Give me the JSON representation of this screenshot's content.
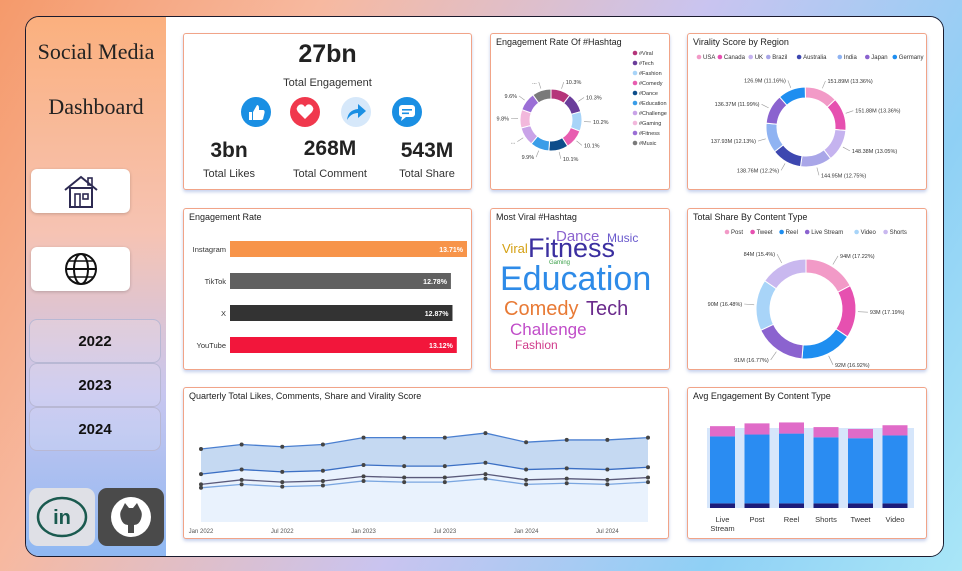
{
  "sidebar": {
    "title_line1": "Social Media",
    "title_line2": "Dashboard",
    "nav": [
      {
        "icon": "home-icon"
      },
      {
        "icon": "globe-icon"
      }
    ],
    "years": [
      "2022",
      "2023",
      "2024"
    ],
    "social": [
      {
        "icon": "linkedin-icon"
      },
      {
        "icon": "github-icon"
      }
    ]
  },
  "kpi": {
    "total_engagement_value": "27bn",
    "total_engagement_label": "Total Engagement",
    "likes_value": "3bn",
    "likes_label": "Total Likes",
    "comment_value": "268M",
    "comment_label": "Total Comment",
    "share_value": "543M",
    "share_label": "Total Share",
    "icons": [
      "like-icon",
      "heart-icon",
      "share-icon",
      "comment-icon"
    ],
    "icon_color": "#1a8fe3",
    "heart_color": "#f0384d"
  },
  "chart_data": [
    {
      "id": "hashtag_engagement",
      "type": "pie",
      "title": "Engagement Rate Of #Hashtag",
      "donut": true,
      "labels": [
        "#Viral",
        "#Tech",
        "#Fashion",
        "#Comedy",
        "#Dance",
        "#Education",
        "#Challenge",
        "#Gaming",
        "#Fitness",
        "#Music"
      ],
      "values": [
        10.3,
        10.3,
        10.2,
        10.1,
        10.1,
        9.9,
        9.8,
        9.6,
        9.6,
        9.9
      ],
      "data_labels": [
        "10.3%",
        "10.3%",
        "10.2%",
        "10.1%",
        "10.1%",
        "9.9%",
        "...",
        "9.8%",
        "9.6%",
        "..."
      ],
      "colors": [
        "#b5357a",
        "#6a3d9a",
        "#a8d4f8",
        "#e85db0",
        "#0d4d8a",
        "#3a9de8",
        "#c9a3e8",
        "#f2b8dc",
        "#9b6fd6",
        "#7a7a7a"
      ],
      "legend_position": "right"
    },
    {
      "id": "virality_region",
      "type": "pie",
      "title": "Virality Score by Region",
      "donut": true,
      "labels": [
        "USA",
        "Canada",
        "UK",
        "Brazil",
        "Australia",
        "India",
        "Japan",
        "Germany"
      ],
      "values": [
        151.89,
        151.88,
        148.38,
        144.95,
        138.76,
        137.93,
        136.37,
        126.9
      ],
      "data_labels": [
        "151.89M (13.36%)",
        "151.88M (13.36%)",
        "148.38M (13.05%)",
        "144.95M (12.75%)",
        "138.76M (12.2%)",
        "137.93M (12.13%)",
        "136.37M (11.99%)",
        "126.9M (11.16%)"
      ],
      "colors": [
        "#f29ac7",
        "#e650b0",
        "#c5b3ef",
        "#a9a6e8",
        "#3d47b0",
        "#8fb3f2",
        "#8b63cf",
        "#1e8ef0"
      ],
      "legend_position": "top"
    },
    {
      "id": "engagement_rate",
      "type": "bar",
      "orientation": "horizontal",
      "title": "Engagement Rate",
      "categories": [
        "Instagram",
        "TikTok",
        "X",
        "YouTube"
      ],
      "values": [
        13.71,
        12.78,
        12.87,
        13.12
      ],
      "data_labels": [
        "13.71%",
        "12.78%",
        "12.87%",
        "13.12%"
      ],
      "colors": [
        "#f7944a",
        "#606060",
        "#333333",
        "#f2163b"
      ],
      "xlim": [
        0,
        13.71
      ]
    },
    {
      "id": "viral_hashtag_cloud",
      "type": "table",
      "title": "Most Viral #Hashtag",
      "words": [
        {
          "text": "Dance",
          "color": "#8b63cf"
        },
        {
          "text": "Music",
          "color": "#6a5acd"
        },
        {
          "text": "Viral",
          "color": "#d4a012"
        },
        {
          "text": "Fitness",
          "color": "#3b2fa0"
        },
        {
          "text": "Gaming",
          "color": "#3aa048"
        },
        {
          "text": "Education",
          "color": "#2e8be8"
        },
        {
          "text": "Comedy",
          "color": "#e87a35"
        },
        {
          "text": "Tech",
          "color": "#6a2a8c"
        },
        {
          "text": "Challenge",
          "color": "#c04cc8"
        },
        {
          "text": "Fashion",
          "color": "#d03a8a"
        }
      ]
    },
    {
      "id": "share_content_type",
      "type": "pie",
      "title": "Total Share By Content Type",
      "donut": true,
      "labels": [
        "Post",
        "Tweet",
        "Reel",
        "Live Stream",
        "Video",
        "Shorts"
      ],
      "values": [
        94,
        93,
        92,
        91,
        90,
        84
      ],
      "data_labels": [
        "94M (17.22%)",
        "93M (17.19%)",
        "92M (16.92%)",
        "91M (16.77%)",
        "90M (16.48%)",
        "84M (15.4%)"
      ],
      "colors": [
        "#f29ac7",
        "#e650b0",
        "#1e8ef0",
        "#8b63cf",
        "#a8d4f8",
        "#c9b8ef"
      ],
      "legend_position": "top"
    },
    {
      "id": "quarterly_trend",
      "type": "area",
      "title": "Quarterly Total Likes, Comments, Share and Virality Score",
      "x": [
        "Jan 2022",
        "Apr 2022",
        "Jul 2022",
        "Oct 2022",
        "Jan 2023",
        "Apr 2023",
        "Jul 2023",
        "Oct 2023",
        "Jan 2024",
        "Apr 2024",
        "Jul 2024",
        "Oct 2024"
      ],
      "x_ticks": [
        "Jan 2022",
        "Jul 2022",
        "Jan 2023",
        "Jul 2023",
        "Jan 2024",
        "Jul 2024"
      ],
      "series": [
        {
          "values": [
            64,
            68,
            66,
            68,
            74,
            74,
            74,
            78,
            70,
            72,
            72,
            74
          ],
          "color": "#4a7fd0"
        },
        {
          "values": [
            42,
            46,
            44,
            45,
            50,
            49,
            49,
            52,
            46,
            47,
            46,
            48
          ],
          "color": "#3b6fc4"
        },
        {
          "values": [
            33,
            37,
            35,
            36,
            40,
            39,
            39,
            42,
            37,
            38,
            37,
            39
          ],
          "color": "#5a5a7a"
        },
        {
          "values": [
            30,
            33,
            31,
            32,
            36,
            35,
            35,
            38,
            33,
            34,
            33,
            35
          ],
          "color": "#7aa6e0"
        }
      ],
      "ylim": [
        0,
        100
      ],
      "grid": false
    },
    {
      "id": "avg_engagement_content",
      "type": "bar",
      "stacked": true,
      "title": "Avg Engagement By Content Type",
      "categories": [
        "Live Stream",
        "Post",
        "Reel",
        "Shorts",
        "Tweet",
        "Video"
      ],
      "series": [
        {
          "values": [
            5,
            5,
            5,
            5,
            5,
            5
          ],
          "color": "#1c1c7a"
        },
        {
          "values": [
            72,
            74,
            75,
            71,
            70,
            73
          ],
          "color": "#2a8cf2"
        },
        {
          "values": [
            11,
            12,
            12,
            11,
            10,
            11
          ],
          "color": "#e06bc8"
        }
      ],
      "gap_color": "#d6e6fb",
      "ylim": [
        0,
        100
      ]
    }
  ]
}
